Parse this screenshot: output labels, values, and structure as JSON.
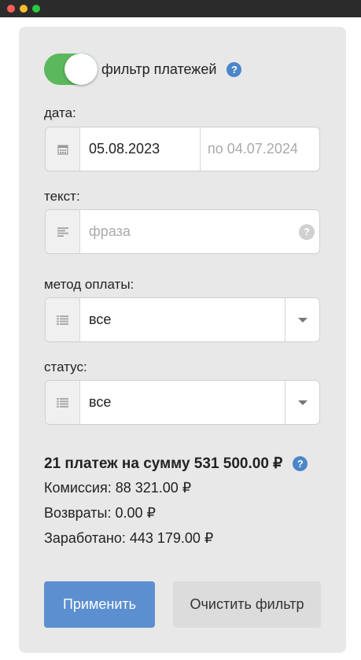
{
  "window": {
    "controls": [
      "close",
      "minimize",
      "maximize"
    ]
  },
  "filter": {
    "toggle_label": "фильтр платежей",
    "toggle_on": true,
    "help_glyph": "?",
    "date": {
      "label": "дата:",
      "from": "05.08.2023",
      "to_placeholder": "по 04.07.2024"
    },
    "text": {
      "label": "текст:",
      "placeholder": "фраза",
      "help_glyph": "?"
    },
    "payment_method": {
      "label": "метод оплаты:",
      "value": "все"
    },
    "status": {
      "label": "статус:",
      "value": "все"
    }
  },
  "summary": {
    "title": "21 платеж на сумму 531 500.00 ₽",
    "help_glyph": "?",
    "commission": "Комиссия: 88 321.00 ₽",
    "refunds": "Возвраты: 0.00 ₽",
    "earned": "Заработано: 443 179.00 ₽"
  },
  "actions": {
    "apply_label": "Применить",
    "clear_label": "Очистить фильтр"
  },
  "colors": {
    "toggle_on": "#5cb85c",
    "help": "#4a86c8",
    "primary_button": "#5c8fcf",
    "panel": "#e8e8e8"
  }
}
